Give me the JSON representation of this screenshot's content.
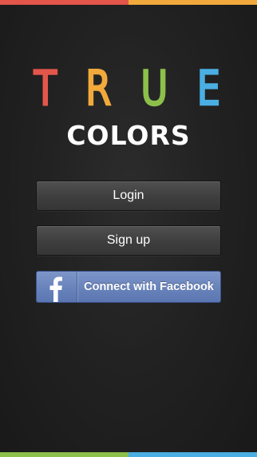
{
  "app": {
    "logo": {
      "letters": [
        {
          "char": "T",
          "color": "#e4564b"
        },
        {
          "char": "R",
          "color": "#f2a93b"
        },
        {
          "char": "U",
          "color": "#8cc04b"
        },
        {
          "char": "E",
          "color": "#4aaee3"
        }
      ],
      "subtitle": "COLORS"
    },
    "buttons": {
      "login_label": "Login",
      "signup_label": "Sign up",
      "facebook_label": "Connect with Facebook"
    },
    "stripe_colors": {
      "top": [
        "#e4564b",
        "#f2a93b"
      ],
      "bottom": [
        "#8cc04b",
        "#4aaee3"
      ]
    },
    "facebook_color": "#6a84bc"
  }
}
